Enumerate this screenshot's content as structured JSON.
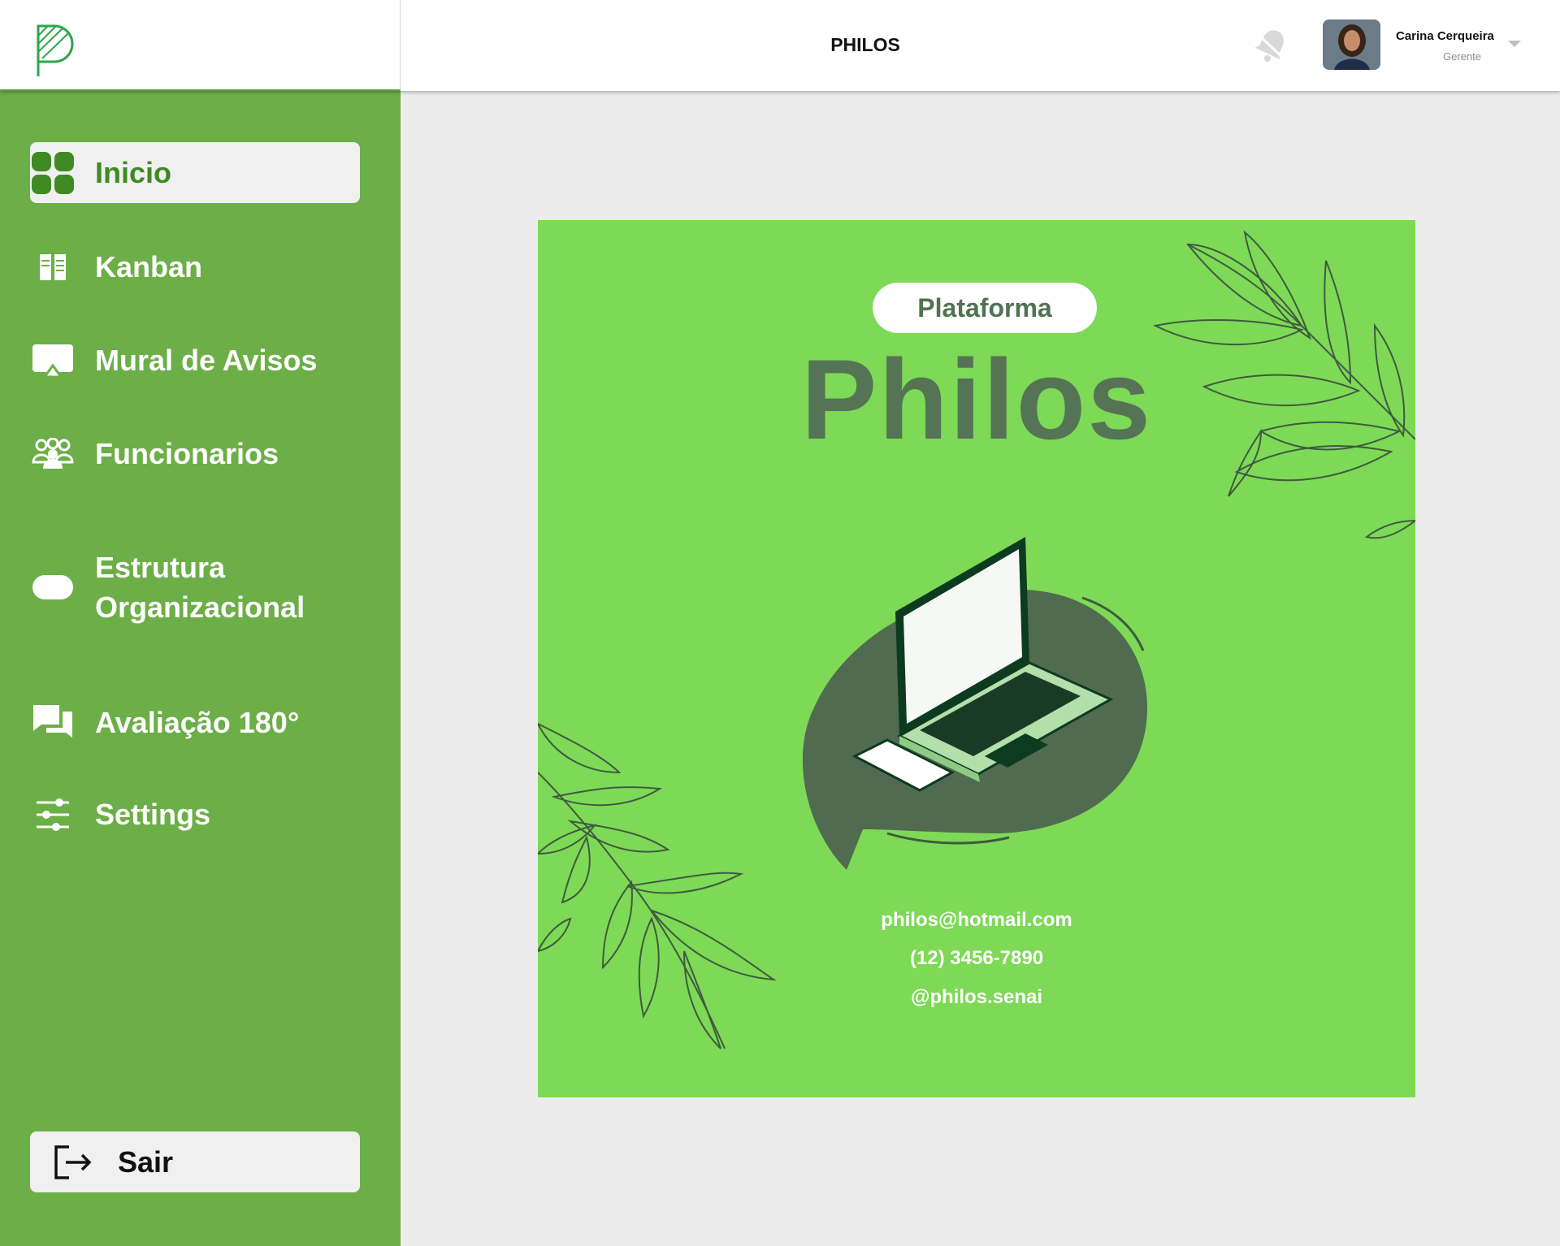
{
  "header": {
    "title": "PHILOS",
    "user": {
      "name": "Carina Cerqueira",
      "role": "Gerente"
    }
  },
  "sidebar": {
    "items": [
      {
        "label": "Inicio",
        "icon": "grid-icon",
        "active": true
      },
      {
        "label": "Kanban",
        "icon": "kanban-icon"
      },
      {
        "label": "Mural de Avisos",
        "icon": "board-icon"
      },
      {
        "label": "Funcionarios",
        "icon": "people-icon"
      },
      {
        "label": "Estrutura",
        "label2": "Organizacional",
        "icon": "pill-icon"
      },
      {
        "label": "Avaliação 180°",
        "icon": "chat-icon"
      },
      {
        "label": "Settings",
        "icon": "sliders-icon"
      }
    ],
    "logout": {
      "label": "Sair",
      "icon": "logout-icon"
    }
  },
  "poster": {
    "tag": "Plataforma",
    "title": "Philos",
    "email": "philos@hotmail.com",
    "phone": "(12) 3456-7890",
    "social": "@philos.senai"
  },
  "colors": {
    "sidebar": "#6cae47",
    "active_text": "#3f8a23",
    "poster_bg": "#7dd956",
    "poster_title": "#557355"
  }
}
